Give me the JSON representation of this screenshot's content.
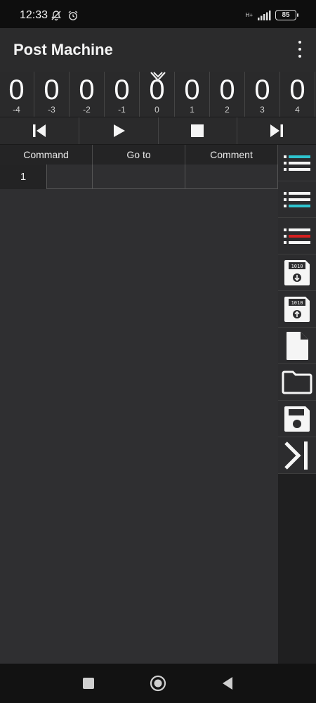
{
  "status": {
    "time": "12:33",
    "network": "H+",
    "battery": "85"
  },
  "app": {
    "title": "Post Machine"
  },
  "tape": {
    "cells": [
      {
        "value": "0",
        "index": "-4"
      },
      {
        "value": "0",
        "index": "-3"
      },
      {
        "value": "0",
        "index": "-2"
      },
      {
        "value": "0",
        "index": "-1"
      },
      {
        "value": "0",
        "index": "0"
      },
      {
        "value": "0",
        "index": "1"
      },
      {
        "value": "0",
        "index": "2"
      },
      {
        "value": "0",
        "index": "3"
      },
      {
        "value": "0",
        "index": "4"
      }
    ]
  },
  "table": {
    "columns": [
      "Command",
      "Go to",
      "Comment"
    ],
    "rows": [
      {
        "number": "1",
        "command": "",
        "goto": "",
        "comment": ""
      }
    ]
  },
  "colors": {
    "accent_cyan": "#2ec4cf",
    "accent_red": "#d62020",
    "icon_white": "#f5f5f5"
  },
  "side_buttons": [
    "list-cyan-icon",
    "list-cyan-alt-icon",
    "list-red-icon",
    "binary-save-icon",
    "binary-load-icon",
    "new-file-icon",
    "folder-icon",
    "floppy-save-icon",
    "collapse-panel-icon"
  ]
}
